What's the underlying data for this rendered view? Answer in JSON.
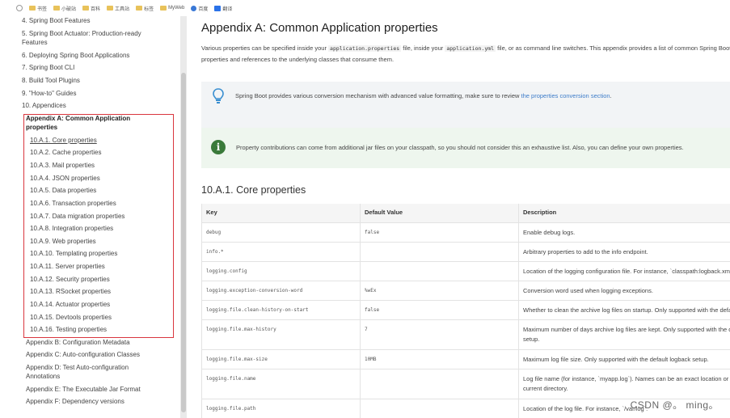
{
  "bookmarks": {
    "items": [
      "书签",
      "小破站",
      "百科",
      "工具站",
      "标签",
      "MyWeb",
      "百度",
      "翻译"
    ]
  },
  "sidebar": {
    "items_top": [
      "4. Spring Boot Features",
      "5. Spring Boot Actuator: Production-ready Features",
      "6. Deploying Spring Boot Applications",
      "7. Spring Boot CLI",
      "8. Build Tool Plugins",
      "9. \"How-to\" Guides",
      "10. Appendices"
    ],
    "active_section": "Appendix A: Common Application properties",
    "sub_items": [
      "10.A.1. Core properties",
      "10.A.2. Cache properties",
      "10.A.3. Mail properties",
      "10.A.4. JSON properties",
      "10.A.5. Data properties",
      "10.A.6. Transaction properties",
      "10.A.7. Data migration properties",
      "10.A.8. Integration properties",
      "10.A.9. Web properties",
      "10.A.10. Templating properties",
      "10.A.11. Server properties",
      "10.A.12. Security properties",
      "10.A.13. RSocket properties",
      "10.A.14. Actuator properties",
      "10.A.15. Devtools properties",
      "10.A.16. Testing properties"
    ],
    "items_bottom": [
      "Appendix B: Configuration Metadata",
      "Appendix C: Auto-configuration Classes",
      "Appendix D: Test Auto-configuration Annotations",
      "Appendix E: The Executable Jar Format",
      "Appendix F: Dependency versions"
    ]
  },
  "main": {
    "title": "Appendix A: Common Application properties",
    "intro_1": "Various properties can be specified inside your",
    "intro_code_1": "application.properties",
    "intro_2": "file, inside your",
    "intro_code_2": "application.yml",
    "intro_3": "file, or as command line switches. This appendix provides a list of common Spring Boot",
    "intro_4": "properties and references to the underlying classes that consume them.",
    "tip_text": "Spring Boot provides various conversion mechanism with advanced value formatting, make sure to review",
    "tip_link": "the properties conversion section",
    "important_text": "Property contributions can come from additional jar files on your classpath, so you should not consider this an exhaustive list. Also, you can define your own properties.",
    "section_title": "10.A.1. Core properties"
  },
  "table": {
    "headers": [
      "Key",
      "Default Value",
      "Description"
    ],
    "rows": [
      {
        "key": "debug",
        "default": "false",
        "description": "Enable debug logs."
      },
      {
        "key": "info.*",
        "default": "",
        "description": "Arbitrary properties to add to the info endpoint."
      },
      {
        "key": "logging.config",
        "default": "",
        "description": "Location of the logging configuration file. For instance, `classpath:logback.xml` for Logback."
      },
      {
        "key": "logging.exception-conversion-word",
        "default": "%wEx",
        "description": "Conversion word used when logging exceptions."
      },
      {
        "key": "logging.file.clean-history-on-start",
        "default": "false",
        "description": "Whether to clean the archive log files on startup. Only supported with the default logback setup."
      },
      {
        "key": "logging.file.max-history",
        "default": "7",
        "description": "Maximum number of days archive log files are kept. Only supported with the default logback",
        "description_2": "setup."
      },
      {
        "key": "logging.file.max-size",
        "default": "10MB",
        "description": "Maximum log file size. Only supported with the default logback setup."
      },
      {
        "key": "logging.file.name",
        "default": "",
        "description": "Log file name (for instance, `myapp.log`). Names can be an exact location or relative to the",
        "description_2": "current directory."
      },
      {
        "key": "logging.file.path",
        "default": "",
        "description": "Location of the log file. For instance, `/var/log`."
      }
    ]
  },
  "watermark": "CSDN @。 ming。"
}
